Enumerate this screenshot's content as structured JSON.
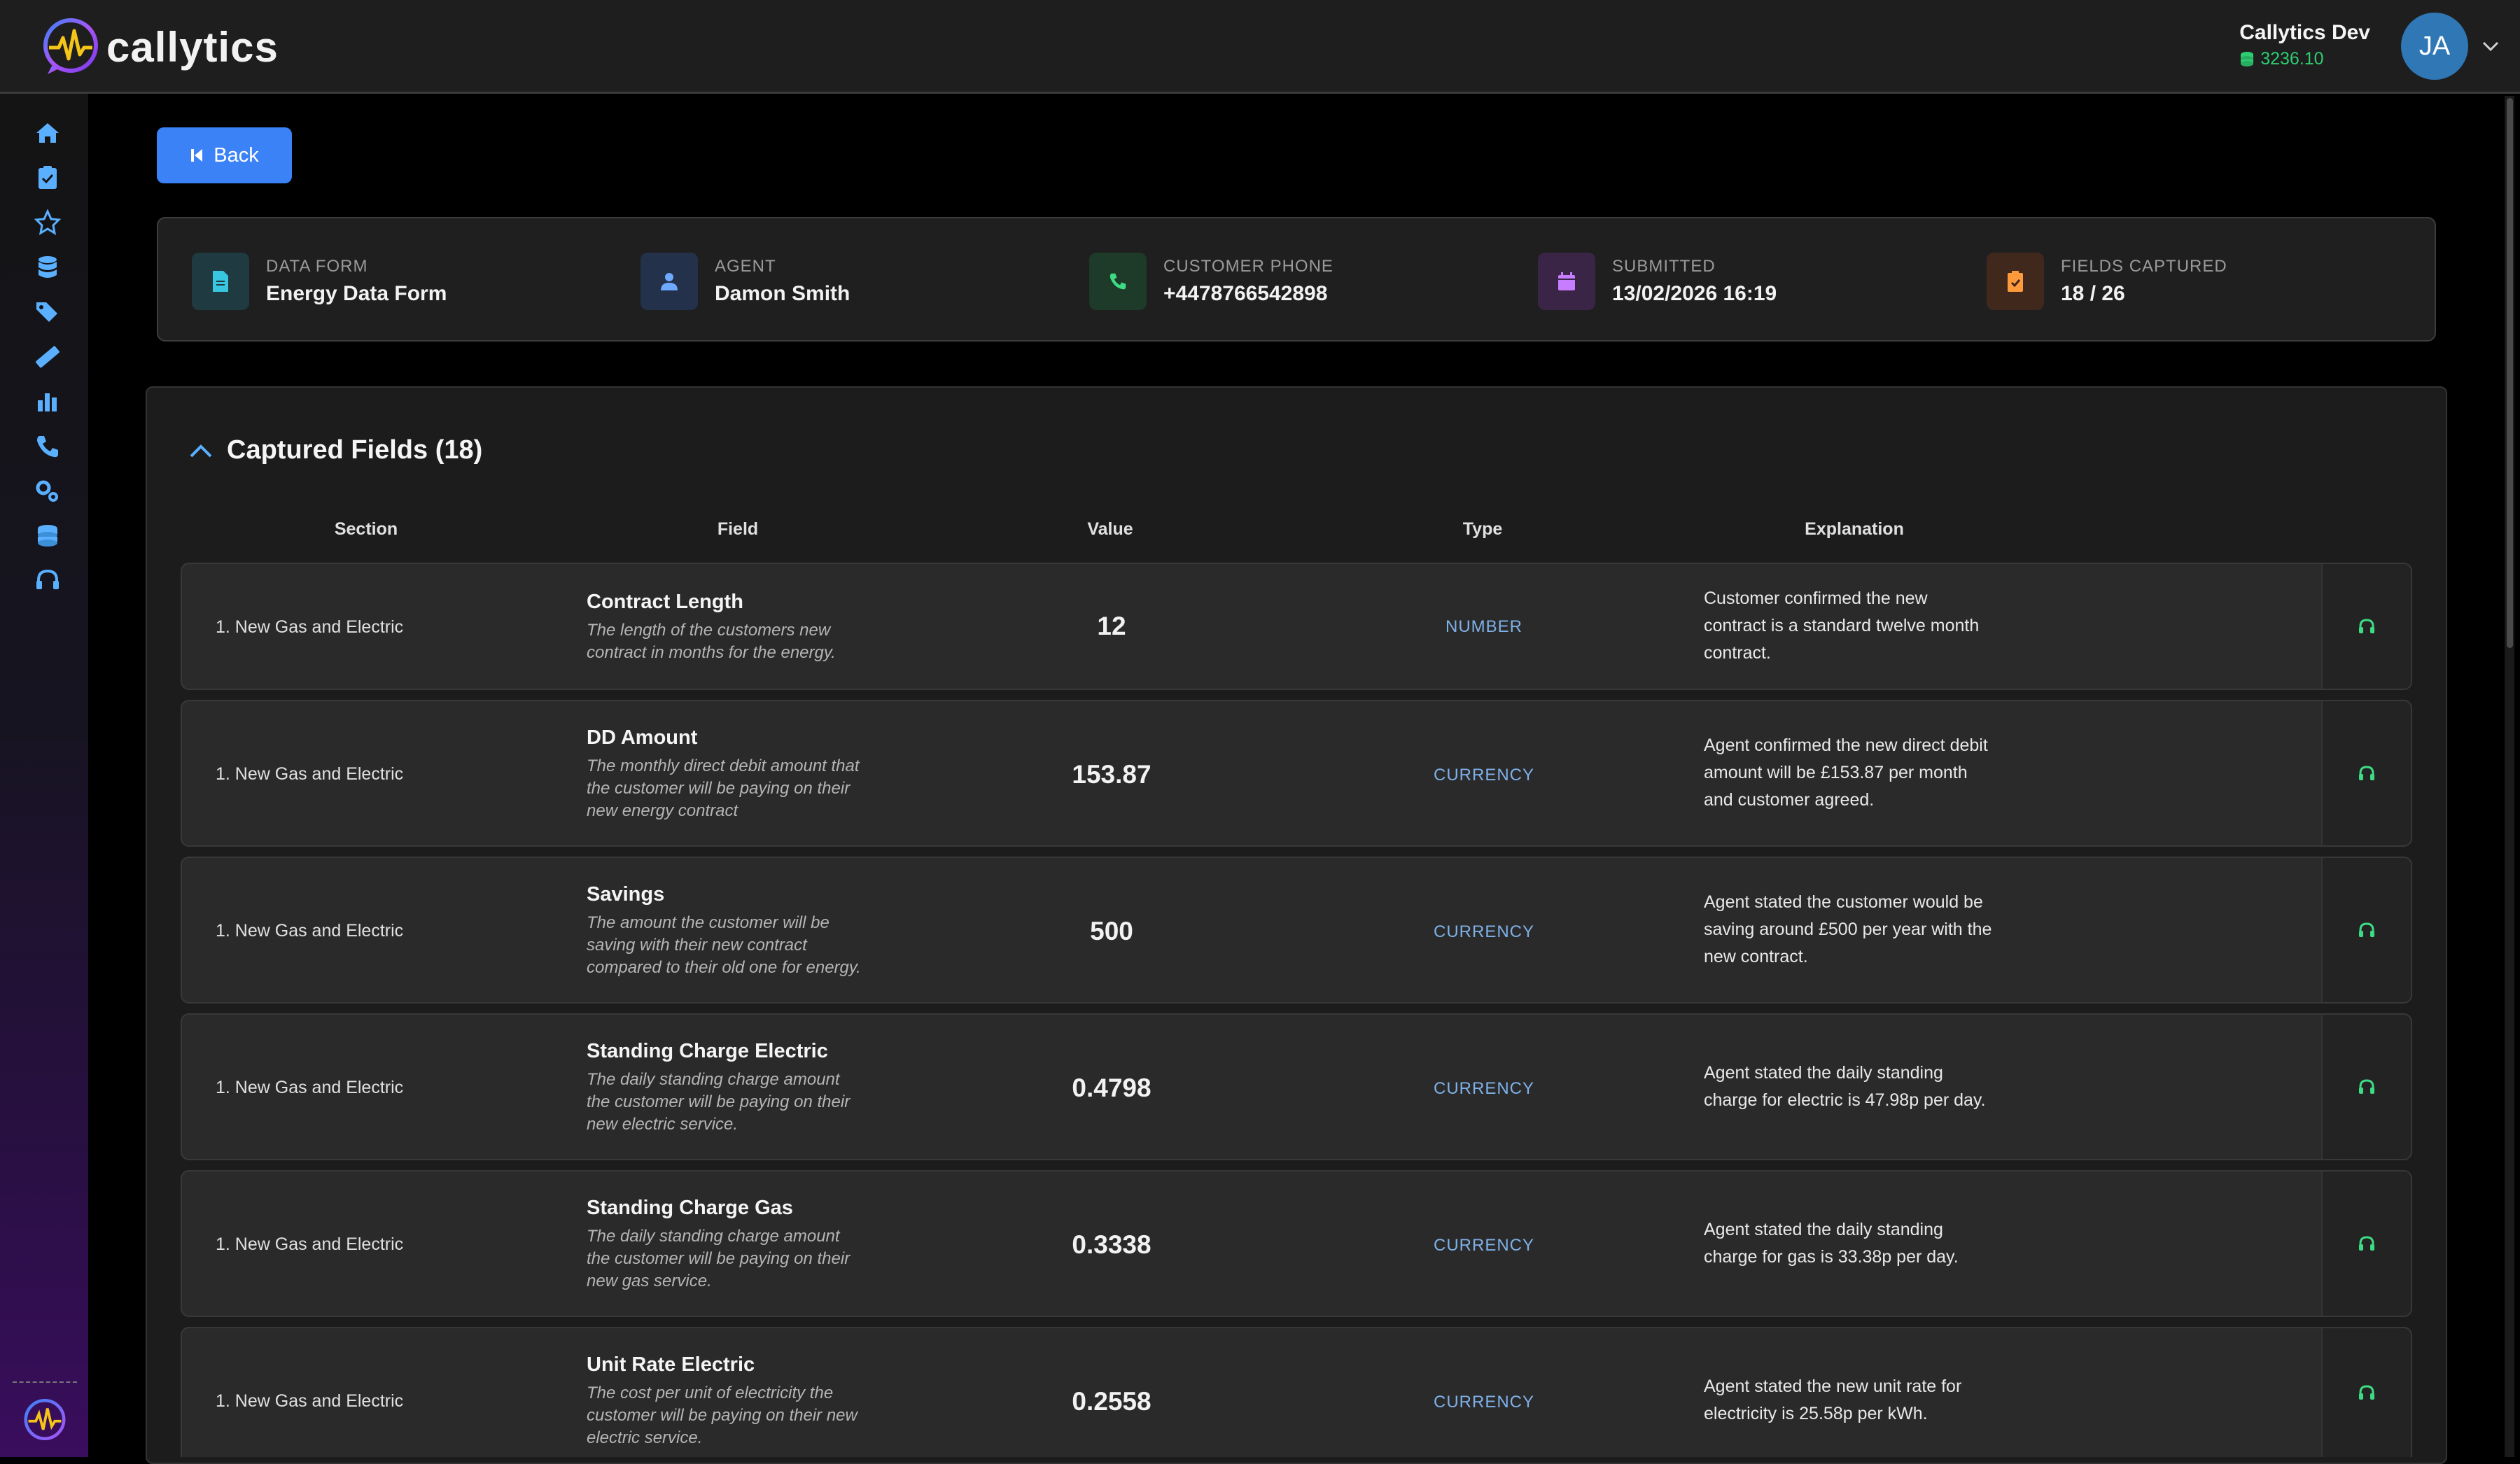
{
  "app": {
    "logo_text": "callytics",
    "user_name": "Callytics Dev",
    "user_credits": "3236.10",
    "avatar_initials": "JA"
  },
  "sidebar": {
    "items": [
      {
        "icon": "home-icon"
      },
      {
        "icon": "clipboard-check-icon"
      },
      {
        "icon": "star-icon"
      },
      {
        "icon": "database-icon"
      },
      {
        "icon": "tags-icon"
      },
      {
        "icon": "ruler-icon"
      },
      {
        "icon": "bar-chart-icon"
      },
      {
        "icon": "phone-icon"
      },
      {
        "icon": "cogs-icon"
      },
      {
        "icon": "coins-icon"
      },
      {
        "icon": "headset-icon"
      }
    ]
  },
  "back_button": {
    "label": "Back"
  },
  "info": {
    "data_form_label": "DATA FORM",
    "data_form_value": "Energy Data Form",
    "agent_label": "AGENT",
    "agent_value": "Damon Smith",
    "phone_label": "CUSTOMER PHONE",
    "phone_value": "+4478766542898",
    "submitted_label": "SUBMITTED",
    "submitted_value": "13/02/2026 16:19",
    "fields_label": "FIELDS CAPTURED",
    "fields_value": "18 / 26"
  },
  "panel": {
    "title": "Captured Fields (18)",
    "columns": {
      "section": "Section",
      "field": "Field",
      "value": "Value",
      "type": "Type",
      "explanation": "Explanation"
    }
  },
  "rows": [
    {
      "section": "1. New Gas and Electric",
      "field": "Contract Length",
      "desc_lines": [
        "The length of the customers new",
        "contract in months for the energy."
      ],
      "value": "12",
      "type": "NUMBER",
      "expl_lines": [
        "Customer confirmed the new",
        "contract is a standard twelve month",
        "contract."
      ]
    },
    {
      "section": "1. New Gas and Electric",
      "field": "DD Amount",
      "desc_lines": [
        "The monthly direct debit amount that",
        "the customer will be paying on their",
        "new energy contract"
      ],
      "value": "153.87",
      "type": "CURRENCY",
      "expl_lines": [
        "Agent confirmed the new direct debit",
        "amount will be £153.87 per month",
        "and customer agreed."
      ]
    },
    {
      "section": "1. New Gas and Electric",
      "field": "Savings",
      "desc_lines": [
        "The amount the customer will be",
        "saving with their new contract",
        "compared to their old one for energy."
      ],
      "value": "500",
      "type": "CURRENCY",
      "expl_lines": [
        "Agent stated the customer would be",
        "saving around £500 per year with the",
        "new contract."
      ]
    },
    {
      "section": "1. New Gas and Electric",
      "field": "Standing Charge Electric",
      "desc_lines": [
        "The daily standing charge amount",
        "the customer will be paying on their",
        "new electric service."
      ],
      "value": "0.4798",
      "type": "CURRENCY",
      "expl_lines": [
        "Agent stated the daily standing",
        "charge for electric is 47.98p per day."
      ]
    },
    {
      "section": "1. New Gas and Electric",
      "field": "Standing Charge Gas",
      "desc_lines": [
        "The daily standing charge amount",
        "the customer will be paying on their",
        "new gas service."
      ],
      "value": "0.3338",
      "type": "CURRENCY",
      "expl_lines": [
        "Agent stated the daily standing",
        "charge for gas is 33.38p per day."
      ]
    },
    {
      "section": "1. New Gas and Electric",
      "field": "Unit Rate Electric",
      "desc_lines": [
        "The cost per unit of electricity the",
        "customer will be paying on their new",
        "electric service."
      ],
      "value": "0.2558",
      "type": "CURRENCY",
      "expl_lines": [
        "Agent stated the new unit rate for",
        "electricity is 25.58p per kWh."
      ]
    }
  ]
}
